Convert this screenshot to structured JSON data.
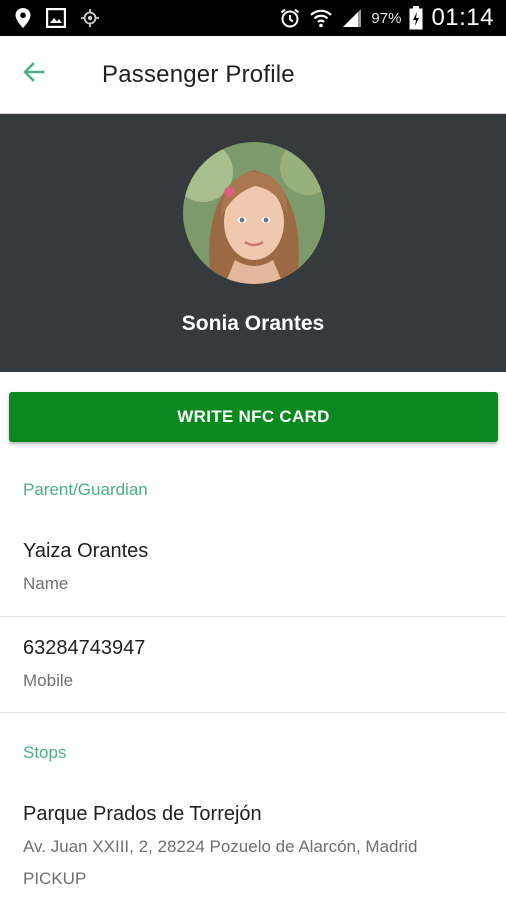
{
  "status_bar": {
    "battery_percent": "97%",
    "time": "01:14",
    "icons": [
      "location-icon",
      "image-icon",
      "gps-icon",
      "alarm-icon",
      "wifi-icon",
      "signal-icon",
      "battery-icon"
    ]
  },
  "app_bar": {
    "title": "Passenger Profile",
    "back_icon": "arrow-left-icon"
  },
  "profile": {
    "name": "Sonia Orantes"
  },
  "nfc_button": {
    "label": "WRITE NFC CARD"
  },
  "guardian_section": {
    "header": "Parent/Guardian",
    "name_value": "Yaiza Orantes",
    "name_label": "Name",
    "mobile_value": "63284743947",
    "mobile_label": "Mobile"
  },
  "stops_section": {
    "header": "Stops",
    "stop_name": "Parque Prados de Torrejón",
    "stop_address": "Av. Juan XXIII, 2, 28224 Pozuelo de Alarcón, Madrid",
    "stop_type": "PICKUP"
  },
  "colors": {
    "accent_green": "#4caf82",
    "button_green": "#0a8a1e",
    "header_dark": "#353b3d"
  }
}
